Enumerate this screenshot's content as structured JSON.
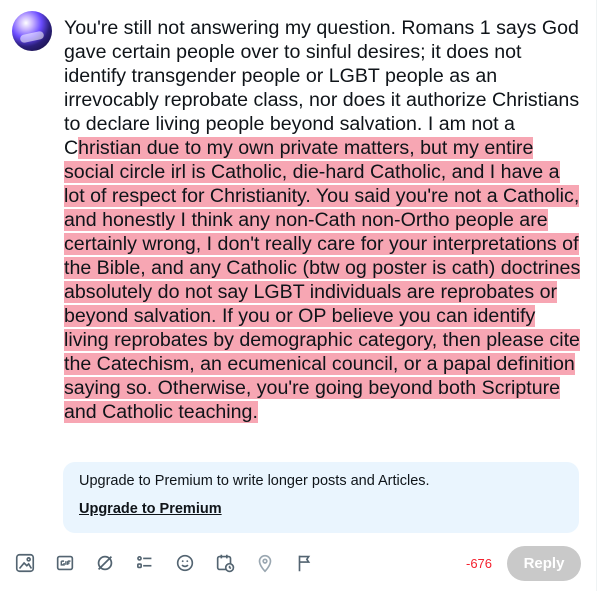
{
  "composer": {
    "text_ok": "You're still not answering my question. Romans 1 says God gave certain people over to sinful desires; it does not identify transgender people or LGBT people as an irrevocably reprobate class, nor does it authorize Christians to declare living people beyond salvation. I am not a C",
    "text_over": "hristian due to my own private matters, but my entire social circle irl is Catholic, die-hard Catholic, and I have a lot of respect for Christianity. You said you're not a Catholic, and honestly I think any non-Cath non-Ortho people are certainly wrong, I don't really care for your interpretations of the Bible, and any Catholic (btw og poster is cath) doctrines absolutely do not say LGBT individuals are reprobates or beyond salvation. If you or OP believe you can identify living reprobates by demographic category, then please cite the Catechism, an ecumenical council, or a papal definition saying so. Otherwise, you're going beyond both Scripture and Catholic teaching."
  },
  "upgrade": {
    "message": "Upgrade to Premium to write longer posts and Articles.",
    "link_label": "Upgrade to Premium"
  },
  "toolbar": {
    "icons": [
      "media-icon",
      "gif-icon",
      "grok-icon",
      "poll-icon",
      "emoji-icon",
      "schedule-icon",
      "location-icon",
      "flag-icon"
    ],
    "counter": "-676",
    "reply_label": "Reply"
  },
  "colors": {
    "overflow_highlight": "#f7a6b3",
    "counter_red": "#f4212e",
    "reply_disabled": "#c9c9c9",
    "accent": "#1d9bf0",
    "premium_box_bg": "#eaf5fe"
  }
}
